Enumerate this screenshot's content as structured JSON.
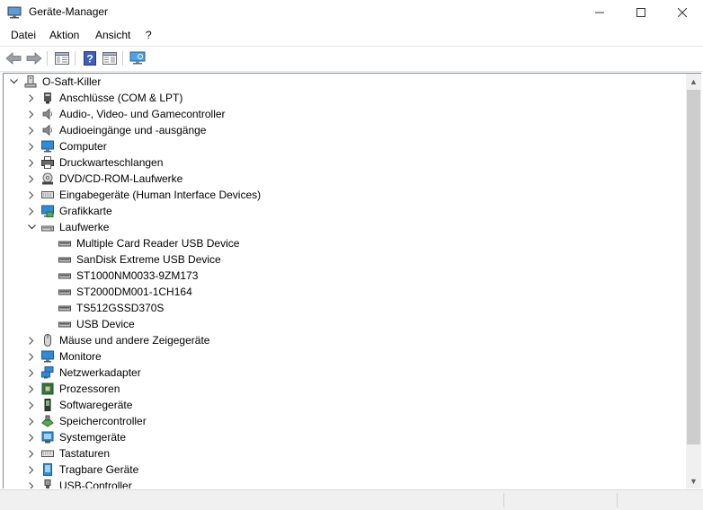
{
  "window": {
    "title": "Geräte-Manager"
  },
  "menu": [
    "Datei",
    "Aktion",
    "Ansicht",
    "?"
  ],
  "tree": {
    "root": "O-Saft-Killer",
    "categories": [
      {
        "label": "Anschlüsse (COM & LPT)",
        "icon": "port-icon"
      },
      {
        "label": "Audio-, Video- und Gamecontroller",
        "icon": "speaker-icon"
      },
      {
        "label": "Audioeingänge und -ausgänge",
        "icon": "speaker-icon"
      },
      {
        "label": "Computer",
        "icon": "computer-icon"
      },
      {
        "label": "Druckwarteschlangen",
        "icon": "printer-icon"
      },
      {
        "label": "DVD/CD-ROM-Laufwerke",
        "icon": "disc-drive-icon"
      },
      {
        "label": "Eingabegeräte (Human Interface Devices)",
        "icon": "hid-icon"
      },
      {
        "label": "Grafikkarte",
        "icon": "display-adapter-icon"
      },
      {
        "label": "Laufwerke",
        "icon": "drive-icon",
        "expanded": true,
        "children": [
          "Multiple Card  Reader USB Device",
          "SanDisk Extreme USB Device",
          "ST1000NM0033-9ZM173",
          "ST2000DM001-1CH164",
          "TS512GSSD370S",
          "USB Device"
        ]
      },
      {
        "label": "Mäuse und andere Zeigegeräte",
        "icon": "mouse-icon"
      },
      {
        "label": "Monitore",
        "icon": "monitor-icon"
      },
      {
        "label": "Netzwerkadapter",
        "icon": "network-icon"
      },
      {
        "label": "Prozessoren",
        "icon": "processor-icon"
      },
      {
        "label": "Softwaregeräte",
        "icon": "software-device-icon"
      },
      {
        "label": "Speichercontroller",
        "icon": "storage-controller-icon"
      },
      {
        "label": "Systemgeräte",
        "icon": "system-device-icon"
      },
      {
        "label": "Tastaturen",
        "icon": "keyboard-icon"
      },
      {
        "label": "Tragbare Geräte",
        "icon": "portable-device-icon"
      },
      {
        "label": "USB-Controller",
        "icon": "usb-icon"
      }
    ]
  },
  "colors": {
    "accent": "#0078d7",
    "monitor": "#2e8bd8"
  }
}
